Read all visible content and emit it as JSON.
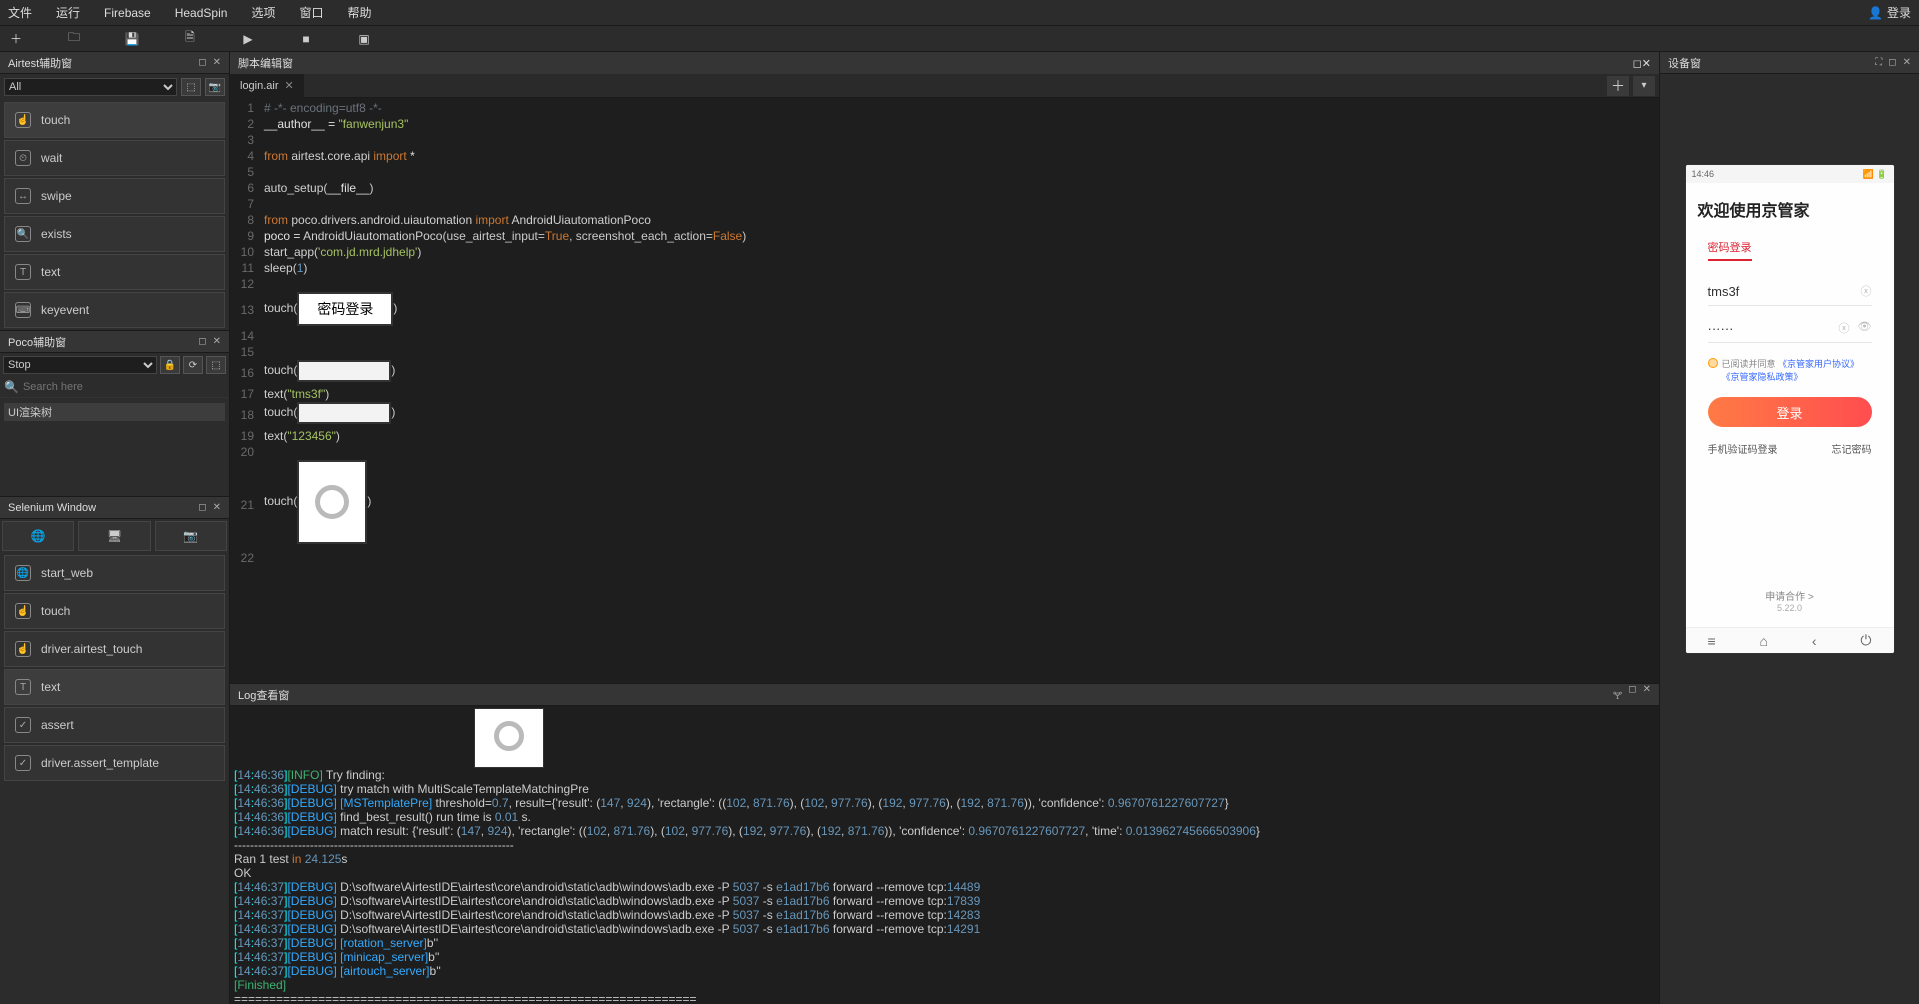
{
  "menu": {
    "items": [
      "文件",
      "运行",
      "Firebase",
      "HeadSpin",
      "选项",
      "窗口",
      "帮助"
    ],
    "login": "登录"
  },
  "airtest_panel": {
    "title": "Airtest辅助窗",
    "select": "All",
    "items": [
      "touch",
      "wait",
      "swipe",
      "exists",
      "text",
      "keyevent"
    ]
  },
  "poco_panel": {
    "title": "Poco辅助窗",
    "select": "Stop",
    "search_ph": "Search here",
    "root": "UI渲染树"
  },
  "selenium_panel": {
    "title": "Selenium Window",
    "items": [
      "start_web",
      "touch",
      "driver.airtest_touch",
      "text",
      "assert",
      "driver.assert_template"
    ]
  },
  "editor": {
    "title": "脚本编辑窗",
    "tab": "login.air",
    "tpl_login_text": "密码登录",
    "code_lines": [
      {
        "n": 1,
        "html": "<span class='c-comment'># -*- encoding=utf8 -*-</span>"
      },
      {
        "n": 2,
        "html": "<span class='c-var'>__author__</span> <span class='c-op'>=</span> <span class='c-str'>\"fanwenjun3\"</span>"
      },
      {
        "n": 3,
        "html": ""
      },
      {
        "n": 4,
        "html": "<span class='c-kw'>from</span> <span class='c-name'>airtest.core.api</span> <span class='c-kw'>import</span> <span class='c-op'>*</span>"
      },
      {
        "n": 5,
        "html": ""
      },
      {
        "n": 6,
        "html": "<span class='c-fn'>auto_setup</span>(<span class='c-var'>__file__</span>)"
      },
      {
        "n": 7,
        "html": ""
      },
      {
        "n": 8,
        "html": "<span class='c-kw'>from</span> <span class='c-name'>poco.drivers.android.uiautomation</span> <span class='c-kw'>import</span> <span class='c-name'>AndroidUiautomationPoco</span>"
      },
      {
        "n": 9,
        "html": "<span class='c-var'>poco</span> <span class='c-op'>=</span> <span class='c-fn'>AndroidUiautomationPoco</span>(use_airtest_input=<span class='c-const'>True</span>, screenshot_each_action=<span class='c-const'>False</span>)"
      },
      {
        "n": 10,
        "html": "<span class='c-fn'>start_app</span>(<span class='c-str'>'com.jd.mrd.jdhelp'</span>)"
      },
      {
        "n": 11,
        "html": "<span class='c-fn'>sleep</span>(<span class='c-num'>1</span>)"
      },
      {
        "n": 12,
        "html": ""
      },
      {
        "n": 13,
        "tpl": "login"
      },
      {
        "n": 14,
        "html": ""
      },
      {
        "n": 15,
        "html": ""
      },
      {
        "n": 16,
        "tpl": "input1"
      },
      {
        "n": 17,
        "html": "<span class='c-fn'>text</span>(<span class='c-str'>\"tms3f\"</span>)"
      },
      {
        "n": 18,
        "tpl": "input2"
      },
      {
        "n": 19,
        "html": "<span class='c-fn'>text</span>(<span class='c-str'>\"123456\"</span>)"
      },
      {
        "n": 20,
        "html": ""
      },
      {
        "n": 21,
        "tpl": "circle"
      },
      {
        "n": 22,
        "html": ""
      }
    ]
  },
  "log": {
    "title": "Log查看窗",
    "lines": [
      "[14:46:36][INFO]<airtest.core.api> Try finding: ",
      "[14:46:36][DEBUG]<airtest.core.api> try match with MultiScaleTemplateMatchingPre",
      "[14:46:36][DEBUG]<airtest.aircv.multiscale_template_matching> [MSTemplatePre] threshold=0.7, result={'result': (147, 924), 'rectangle': ((102, 871.76), (102, 977.76), (192, 977.76), (192, 871.76)), 'confidence': 0.9670761227607727}",
      "[14:46:36][DEBUG]<airtest.aircv.utils> find_best_result() run time is 0.01 s.",
      "[14:46:36][DEBUG]<airtest.core.api> match result: {'result': (147, 924), 'rectangle': ((102, 871.76), (102, 977.76), (192, 977.76), (192, 871.76)), 'confidence': 0.9670761227607727, 'time': 0.013962745666503906}",
      "----------------------------------------------------------------------",
      "Ran 1 test in 24.125s",
      "",
      "OK",
      "[14:46:37][DEBUG]<airtest.core.android.adb> D:\\software\\AirtestIDE\\airtest\\core\\android\\static\\adb\\windows\\adb.exe -P 5037 -s e1ad17b6 forward --remove tcp:14489",
      "[14:46:37][DEBUG]<airtest.core.android.adb> D:\\software\\AirtestIDE\\airtest\\core\\android\\static\\adb\\windows\\adb.exe -P 5037 -s e1ad17b6 forward --remove tcp:17839",
      "[14:46:37][DEBUG]<airtest.core.android.adb> D:\\software\\AirtestIDE\\airtest\\core\\android\\static\\adb\\windows\\adb.exe -P 5037 -s e1ad17b6 forward --remove tcp:14283",
      "[14:46:37][DEBUG]<airtest.core.android.adb> D:\\software\\AirtestIDE\\airtest\\core\\android\\static\\adb\\windows\\adb.exe -P 5037 -s e1ad17b6 forward --remove tcp:14291",
      "[14:46:37][DEBUG]<airtest.utils.nbsp> [rotation_server]b''",
      "[14:46:37][DEBUG]<airtest.utils.nbsp> [minicap_server]b''",
      "[14:46:37][DEBUG]<airtest.utils.nbsp> [airtouch_server]b''",
      "[Finished]",
      "=================================================================="
    ]
  },
  "device": {
    "title": "设备窗",
    "phone": {
      "time": "14:46",
      "heading": "欢迎使用京管家",
      "tab": "密码登录",
      "user_val": "tms3f",
      "pwd_val": "······",
      "agree_text": "已阅读并同意",
      "agree_link1": "《京管家用户协议》",
      "agree_link2": "《京管家隐私政策》",
      "login_btn": "登录",
      "link_left": "手机验证码登录",
      "link_right": "忘记密码",
      "footer1": "申请合作 >",
      "footer2": "5.22.0"
    }
  }
}
